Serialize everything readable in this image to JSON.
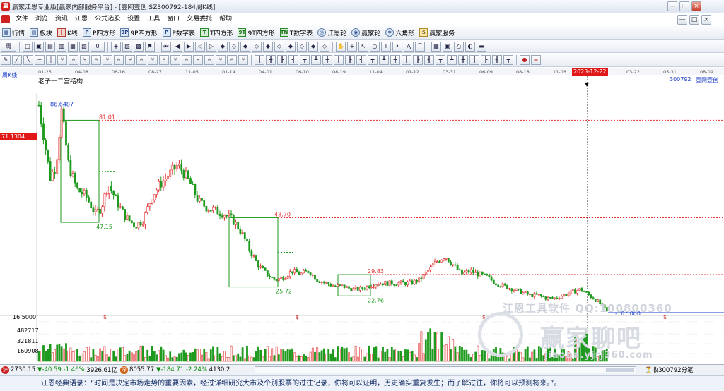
{
  "window": {
    "title": "赢家江恩专业版[赢家内部服务平台] - [壹网壹创  SZ300792-184周K线]",
    "controls": [
      "—",
      "□",
      "×"
    ]
  },
  "menu": [
    "文件",
    "浏览",
    "资讯",
    "江恩",
    "公式选股",
    "设置",
    "工具",
    "窗口",
    "交易委托",
    "帮助"
  ],
  "toolbar1": [
    {
      "label": "行情",
      "icon": "grid-icon"
    },
    {
      "label": "板块",
      "icon": "block-icon"
    },
    {
      "label": "K线",
      "icon": "candle-icon"
    },
    {
      "label": "P四方形",
      "icon": "P"
    },
    {
      "label": "9P四方形",
      "icon": "9P"
    },
    {
      "label": "P数字表",
      "icon": "P"
    },
    {
      "label": "T四方形",
      "icon": "T"
    },
    {
      "label": "9T四方形",
      "icon": "9T"
    },
    {
      "label": "T数字表",
      "icon": "TN"
    },
    {
      "label": "江恩轮",
      "icon": "wheel-icon"
    },
    {
      "label": "赢家轮",
      "icon": "wheel-icon"
    },
    {
      "label": "六角形",
      "icon": "hexagon-icon"
    },
    {
      "label": "赢家服务",
      "icon": "dollar-icon"
    }
  ],
  "toolbar2_lead": "周",
  "toolbar2_zero": "0",
  "chart_meta": {
    "period_label": "周K线",
    "structure_label": "老子十二宫结构",
    "code": "300792",
    "name": "壹网壹创",
    "cursor_date": "2023-12-22",
    "cursor_price": "71.1304",
    "price_low_label": "16.5000",
    "vol_ticks": [
      "482717",
      "321811",
      "160908"
    ]
  },
  "chart_data": {
    "type": "candlestick",
    "x_ticks": [
      "01-23",
      "04-08",
      "06-16",
      "08-27",
      "11-05",
      "01-14",
      "04-01",
      "06-10",
      "08-19",
      "11-04",
      "01-12",
      "03-31",
      "06-09",
      "08-18",
      "11-03",
      "2023-12-22",
      "03-22",
      "05-31",
      "08-09"
    ],
    "annotations": [
      {
        "text": "86.6487",
        "type": "high"
      },
      {
        "text": "81.01",
        "type": "box-top"
      },
      {
        "text": "47.15",
        "type": "box-bottom"
      },
      {
        "text": "48.70",
        "type": "box-top"
      },
      {
        "text": "25.72",
        "type": "box-bottom"
      },
      {
        "text": "29.83",
        "type": "box-top"
      },
      {
        "text": "22.76",
        "type": "box-bottom"
      },
      {
        "text": "-16.5000",
        "type": "low"
      }
    ],
    "boxes": [
      {
        "top": 81.01,
        "bottom": 47.15
      },
      {
        "top": 48.7,
        "bottom": 25.72
      },
      {
        "top": 29.83,
        "bottom": 22.76
      }
    ],
    "ylim": [
      16.5,
      90
    ]
  },
  "watermark": {
    "software": "江恩工具软件  QQ:100800360",
    "forum": "赢家聊吧",
    "url": "jiaoba.yjrj360.com"
  },
  "status": {
    "idx1": {
      "val": "2730.15",
      "chg": "▼-40.59",
      "pct": "-1.46%",
      "amt": "3926.61亿"
    },
    "idx2": {
      "val": "8055.77",
      "chg": "▼-184.71",
      "pct": "-2.24%",
      "amt": "4130.2"
    },
    "right": "收300792分笔"
  },
  "quote": "江恩经典语录：“时间是决定市场走势的重要因素，经过详细研究大市及个别股票的过往记录，你将可以证明，历史确实重复发生；而了解过往，你将可以预测将来。”。"
}
